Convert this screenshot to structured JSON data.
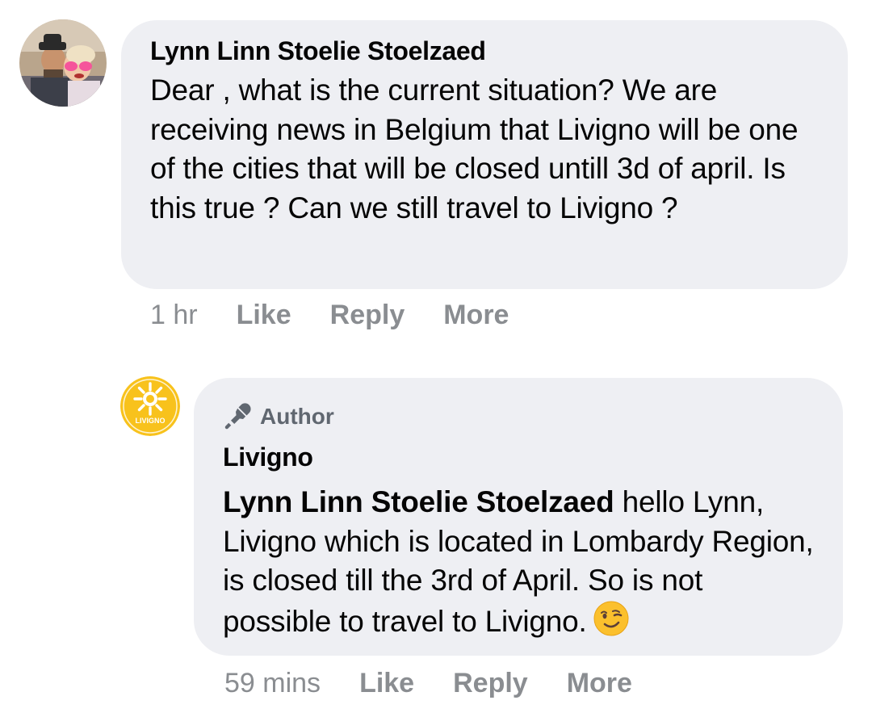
{
  "comment": {
    "author_name": "Lynn Linn Stoelie Stoelzaed",
    "text": "Dear , what is the current situation? We are receiving news in Belgium that Livigno will be one of the cities that will be closed untill 3d of april. Is this true ? Can we still travel to Livigno ?",
    "timestamp": "1 hr",
    "actions": {
      "like": "Like",
      "reply": "Reply",
      "more": "More"
    }
  },
  "reply": {
    "badge_label": "Author",
    "author_name": "Livigno",
    "avatar_text": "LIVIGNO",
    "mention": "Lynn Linn Stoelie Stoelzaed",
    "text": " hello Lynn, Livigno which is located in Lombardy Region, is closed till the 3rd of April. So is not possible to travel to Livigno.",
    "timestamp": "59 mins",
    "actions": {
      "like": "Like",
      "reply": "Reply",
      "more": "More"
    }
  },
  "colors": {
    "bubble_bg": "#eeeff3",
    "meta_text": "#8a8d91",
    "brand_yellow": "#f8c21c"
  },
  "icons": {
    "author_badge": "microphone-icon",
    "emoji": "winking-face-icon"
  }
}
